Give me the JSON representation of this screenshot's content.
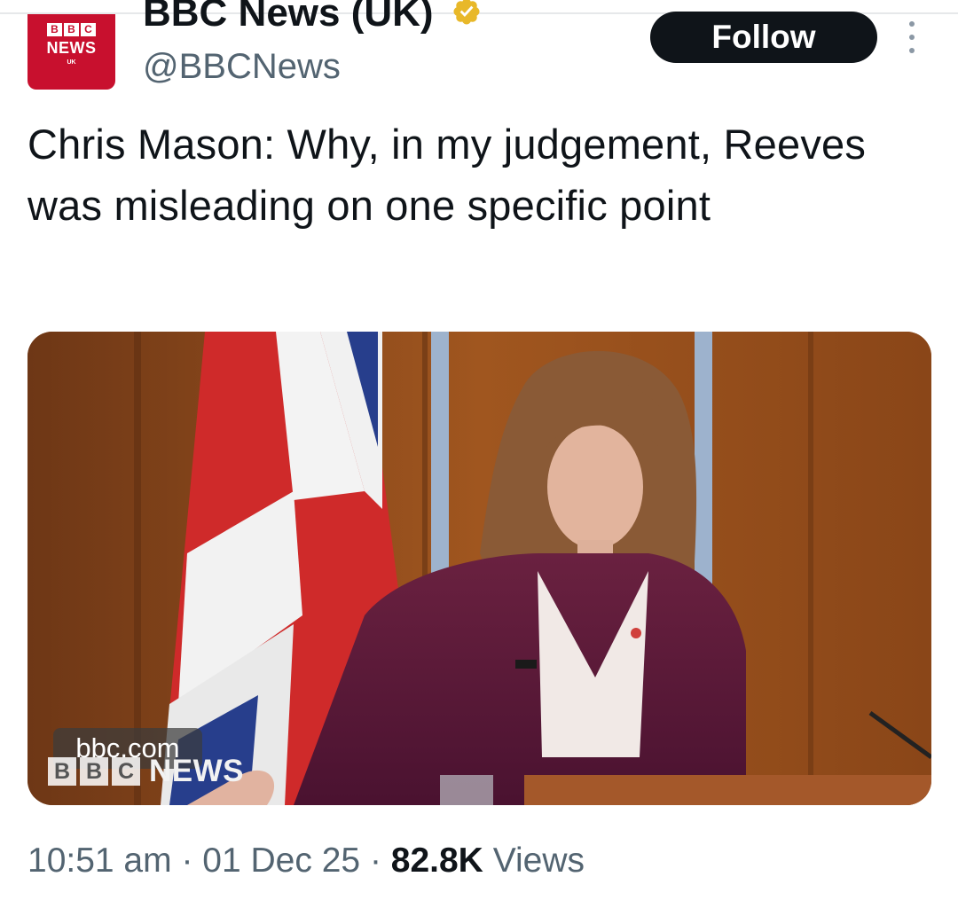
{
  "account": {
    "display_name": "BBC News (UK)",
    "handle": "@BBCNews",
    "avatar": {
      "blocks": [
        "B",
        "B",
        "C"
      ],
      "brand": "NEWS",
      "sub": "UK"
    },
    "verified_icon": "verified-badge-icon",
    "follow_label": "Follow",
    "more_icon": "more-vertical-icon"
  },
  "tweet": {
    "text": "Chris Mason: Why, in my judgement, Reeves was misleading on one specific point"
  },
  "media": {
    "watermark": "bbc.com",
    "logo_blocks": [
      "B",
      "B",
      "C"
    ],
    "logo_text": "NEWS"
  },
  "meta": {
    "time": "10:51 am",
    "separator": "·",
    "date": "01 Dec 25",
    "views_count": "82.8K",
    "views_label": "Views"
  },
  "colors": {
    "brand_red": "#c8102e",
    "text": "#0f1419",
    "muted": "#536471",
    "verified_gold": "#e8b829"
  }
}
